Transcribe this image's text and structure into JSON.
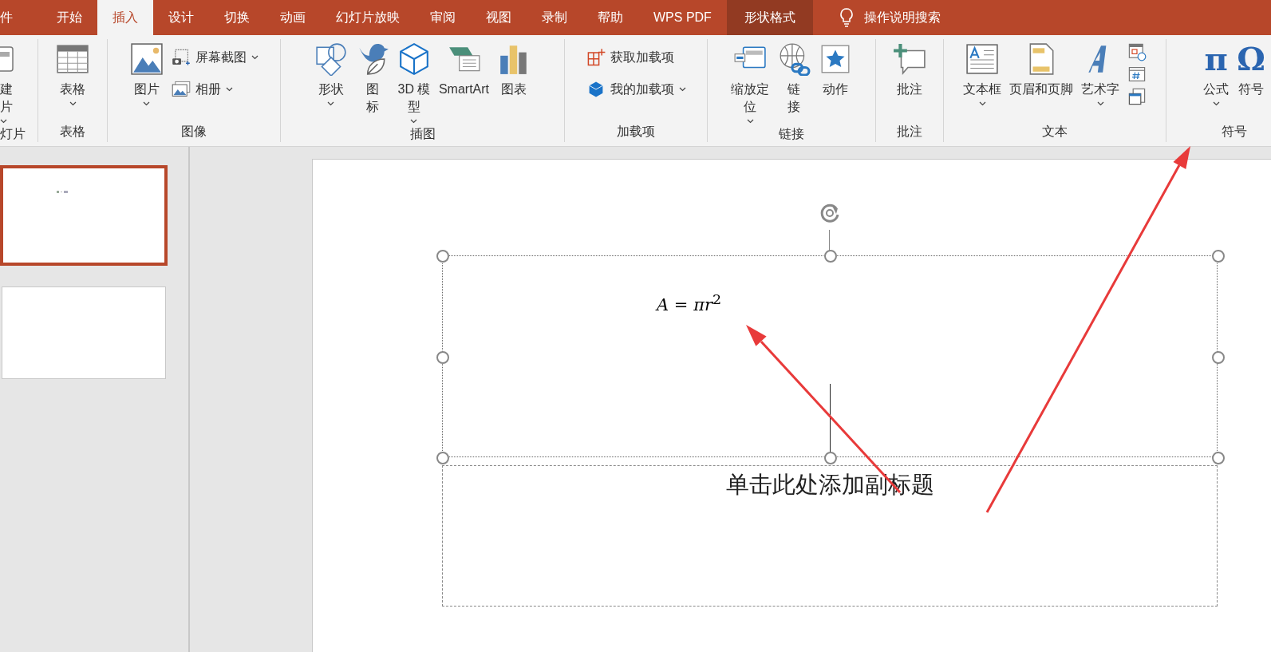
{
  "tabs": [
    {
      "label": "件",
      "selected": false,
      "kind": "tab"
    },
    {
      "label": "开始",
      "selected": false,
      "kind": "tab"
    },
    {
      "label": "插入",
      "selected": true,
      "kind": "tab"
    },
    {
      "label": "设计",
      "selected": false,
      "kind": "tab"
    },
    {
      "label": "切换",
      "selected": false,
      "kind": "tab"
    },
    {
      "label": "动画",
      "selected": false,
      "kind": "tab"
    },
    {
      "label": "幻灯片放映",
      "selected": false,
      "kind": "tab"
    },
    {
      "label": "审阅",
      "selected": false,
      "kind": "tab"
    },
    {
      "label": "视图",
      "selected": false,
      "kind": "tab"
    },
    {
      "label": "录制",
      "selected": false,
      "kind": "tab"
    },
    {
      "label": "帮助",
      "selected": false,
      "kind": "tab"
    },
    {
      "label": "WPS PDF",
      "selected": false,
      "kind": "tab"
    },
    {
      "label": "形状格式",
      "selected": false,
      "kind": "contextual"
    }
  ],
  "tell_me": {
    "placeholder": "操作说明搜索"
  },
  "ribbon": {
    "groups": [
      {
        "label": "灯片",
        "buttons": [
          {
            "lines": [
              "建",
              "片"
            ],
            "kind": "large",
            "dropdown": true
          }
        ]
      },
      {
        "label": "表格",
        "buttons": [
          {
            "label": "表格",
            "kind": "large",
            "dropdown": true
          }
        ]
      },
      {
        "label": "图像",
        "buttons": [
          {
            "label": "图片",
            "kind": "large",
            "dropdown": true
          },
          {
            "label": "屏幕截图",
            "kind": "small",
            "dropdown": true
          },
          {
            "label": "相册",
            "kind": "small",
            "dropdown": true
          }
        ]
      },
      {
        "label": "插图",
        "buttons": [
          {
            "label": "形状",
            "kind": "large",
            "dropdown": true
          },
          {
            "lines": [
              "图",
              "标"
            ],
            "kind": "large",
            "dropdown": false
          },
          {
            "lines": [
              "3D 模",
              "型"
            ],
            "kind": "large",
            "dropdown": true
          },
          {
            "label": "SmartArt",
            "kind": "large",
            "dropdown": false
          },
          {
            "label": "图表",
            "kind": "large",
            "dropdown": false
          }
        ]
      },
      {
        "label": "加载项",
        "buttons": [
          {
            "label": "获取加载项",
            "kind": "small",
            "dropdown": false
          },
          {
            "label": "我的加载项",
            "kind": "small",
            "dropdown": true
          }
        ]
      },
      {
        "label": "链接",
        "buttons": [
          {
            "lines": [
              "缩放定",
              "位"
            ],
            "kind": "large",
            "dropdown": true
          },
          {
            "lines": [
              "链",
              "接"
            ],
            "kind": "large",
            "dropdown": false
          },
          {
            "label": "动作",
            "kind": "large",
            "dropdown": false
          }
        ]
      },
      {
        "label": "批注",
        "buttons": [
          {
            "label": "批注",
            "kind": "large",
            "dropdown": false
          }
        ]
      },
      {
        "label": "文本",
        "buttons": [
          {
            "label": "文本框",
            "kind": "large",
            "dropdown": true
          },
          {
            "label": "页眉和页脚",
            "kind": "large",
            "dropdown": false
          },
          {
            "label": "艺术字",
            "kind": "large",
            "dropdown": true
          },
          {
            "kind": "icon",
            "dropdown": false
          },
          {
            "kind": "icon",
            "dropdown": false
          },
          {
            "kind": "icon",
            "dropdown": false
          }
        ]
      },
      {
        "label": "符号",
        "buttons": [
          {
            "label": "公式",
            "glyph": "π",
            "kind": "large",
            "dropdown": true
          },
          {
            "label": "符号",
            "glyph": "Ω",
            "kind": "large",
            "dropdown": false
          }
        ]
      }
    ]
  },
  "slides": [
    {
      "selected": true
    },
    {
      "selected": false
    }
  ],
  "slide": {
    "title_placeholder": {
      "formula": "*A* = *πr*$^{2}$",
      "selected": true
    },
    "subtitle_placeholder": {
      "placeholder": "单击此处添加副标题"
    }
  }
}
